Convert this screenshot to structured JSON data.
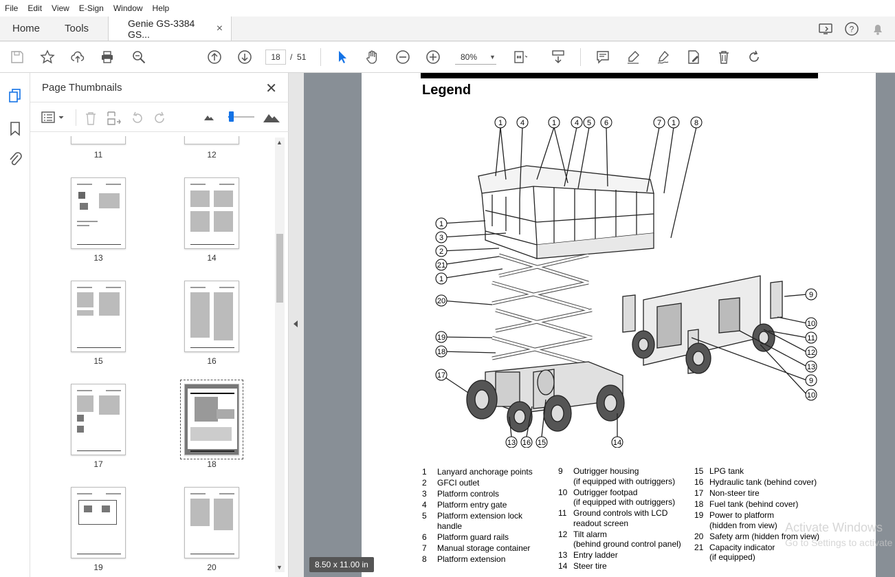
{
  "menu": [
    "File",
    "Edit",
    "View",
    "E-Sign",
    "Window",
    "Help"
  ],
  "tabs": {
    "home": "Home",
    "tools": "Tools",
    "document": "Genie GS-3384 GS...",
    "close": "×"
  },
  "toolbar": {
    "page_current": "18",
    "page_separator": "/",
    "page_total": "51",
    "zoom": "80%"
  },
  "panel": {
    "title": "Page Thumbnails",
    "close": "✕",
    "thumbnails": [
      "11",
      "12",
      "13",
      "14",
      "15",
      "16",
      "17",
      "18",
      "19",
      "20"
    ],
    "selected": "18"
  },
  "document": {
    "heading": "Legend",
    "page_size": "8.50 x 11.00 in",
    "legend_col1": [
      {
        "n": "1",
        "t": "Lanyard anchorage points"
      },
      {
        "n": "2",
        "t": "GFCI outlet"
      },
      {
        "n": "3",
        "t": "Platform controls"
      },
      {
        "n": "4",
        "t": "Platform entry gate"
      },
      {
        "n": "5",
        "t": "Platform extension lock\nhandle"
      },
      {
        "n": "6",
        "t": "Platform guard rails"
      },
      {
        "n": "7",
        "t": "Manual storage container"
      },
      {
        "n": "8",
        "t": "Platform extension"
      }
    ],
    "legend_col2": [
      {
        "n": "9",
        "t": "Outrigger housing\n(if equipped with outriggers)"
      },
      {
        "n": "10",
        "t": "Outrigger footpad\n(if equipped with outriggers)"
      },
      {
        "n": "11",
        "t": "Ground controls with LCD\nreadout screen"
      },
      {
        "n": "12",
        "t": "Tilt alarm\n(behind ground control panel)"
      },
      {
        "n": "13",
        "t": "Entry ladder"
      },
      {
        "n": "14",
        "t": "Steer tire"
      }
    ],
    "legend_col3": [
      {
        "n": "15",
        "t": "LPG tank"
      },
      {
        "n": "16",
        "t": "Hydraulic tank (behind cover)"
      },
      {
        "n": "17",
        "t": "Non-steer tire"
      },
      {
        "n": "18",
        "t": "Fuel tank (behind cover)"
      },
      {
        "n": "19",
        "t": "Power to platform\n(hidden from view)"
      },
      {
        "n": "20",
        "t": "Safety arm (hidden from view)"
      },
      {
        "n": "21",
        "t": "Capacity indicator\n(if equipped)"
      }
    ],
    "callouts_top": [
      "1",
      "4",
      "1",
      "4",
      "5",
      "6",
      "7",
      "1",
      "8"
    ],
    "callouts_left": [
      "1",
      "3",
      "2",
      "21",
      "1",
      "20",
      "19",
      "18",
      "17"
    ],
    "callouts_bottom": [
      "13",
      "16",
      "15",
      "14"
    ],
    "callouts_right": [
      "9",
      "10",
      "11",
      "12",
      "13",
      "9",
      "10"
    ]
  },
  "watermark": {
    "line1": "Activate Windows",
    "line2": "Go to Settings to activate"
  },
  "colors": {
    "accent": "#1473e6",
    "viewer_bg": "#888f96"
  }
}
